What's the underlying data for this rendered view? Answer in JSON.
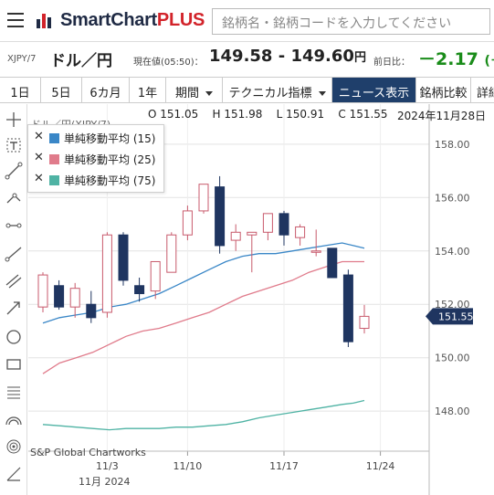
{
  "header": {
    "logo_text": "SmartChart",
    "logo_suffix": "PLUS",
    "search_placeholder": "銘柄名・銘柄コードを入力してください"
  },
  "quote": {
    "code": "XJPY/7",
    "name": "ドル／円",
    "current_label": "現在値(05:50)：",
    "price": "149.58 - 149.60",
    "price_unit": "円",
    "prev_label": "前日比：",
    "change": "－2.17",
    "change_suffix": "(－",
    "change_color": "#1a8c1a"
  },
  "tabs": [
    {
      "label": "1日"
    },
    {
      "label": "5日"
    },
    {
      "label": "6カ月"
    },
    {
      "label": "1年"
    },
    {
      "label": "期間"
    },
    {
      "label": "テクニカル指標"
    },
    {
      "label": "ニュース表示"
    },
    {
      "label": "銘柄比較"
    },
    {
      "label": "詳細"
    }
  ],
  "tools": [
    "crosshair-icon",
    "text-icon",
    "line-icon",
    "trend-icon",
    "horizontal-line-icon",
    "ray-icon",
    "channel-icon",
    "arrow-icon",
    "circle-icon",
    "rectangle-icon",
    "fibonacci-icon",
    "arc-icon",
    "spiral-icon",
    "measure-icon"
  ],
  "ohlc": {
    "o": "O 151.05",
    "h": "H 151.98",
    "l": "L 150.91",
    "c": "C 151.55"
  },
  "date": "2024年11月28日",
  "chart_title_ghost": "ドル／円(XJPY/7)",
  "legend": [
    {
      "x": "✕",
      "label": "単純移動平均 (15)",
      "color": "#3a87c7"
    },
    {
      "x": "✕",
      "label": "単純移動平均 (25)",
      "color": "#e07b8b"
    },
    {
      "x": "✕",
      "label": "単純移動平均 (75)",
      "color": "#4fb3a4"
    }
  ],
  "watermark": "S&P Global Chartworks",
  "x_month_label": "11月 2024",
  "chart_data": {
    "type": "candlestick",
    "ylim": [
      146.5,
      159.5
    ],
    "y_ticks": [
      "158.00",
      "156.00",
      "154.00",
      "152.00",
      "150.00",
      "148.00"
    ],
    "y_tick_values": [
      158,
      156,
      154,
      152,
      150,
      148
    ],
    "x_ticks": [
      {
        "i": 4,
        "label": "11/3"
      },
      {
        "i": 9,
        "label": "11/10"
      },
      {
        "i": 15,
        "label": "11/17"
      },
      {
        "i": 21,
        "label": "11/24"
      }
    ],
    "candles": [
      {
        "o": 151.9,
        "h": 153.2,
        "l": 151.7,
        "c": 153.1
      },
      {
        "o": 152.7,
        "h": 152.9,
        "l": 151.8,
        "c": 151.9
      },
      {
        "o": 151.9,
        "h": 152.8,
        "l": 151.5,
        "c": 152.6
      },
      {
        "o": 152.0,
        "h": 152.5,
        "l": 151.3,
        "c": 151.5
      },
      {
        "o": 151.7,
        "h": 154.7,
        "l": 151.5,
        "c": 154.6
      },
      {
        "o": 154.6,
        "h": 154.7,
        "l": 152.7,
        "c": 152.9
      },
      {
        "o": 152.7,
        "h": 153.0,
        "l": 152.1,
        "c": 152.4
      },
      {
        "o": 152.5,
        "h": 153.6,
        "l": 152.2,
        "c": 153.6
      },
      {
        "o": 153.2,
        "h": 154.7,
        "l": 153.2,
        "c": 154.6
      },
      {
        "o": 154.6,
        "h": 155.7,
        "l": 154.4,
        "c": 155.5
      },
      {
        "o": 155.5,
        "h": 156.5,
        "l": 155.4,
        "c": 156.5
      },
      {
        "o": 156.4,
        "h": 156.8,
        "l": 153.9,
        "c": 154.2
      },
      {
        "o": 154.4,
        "h": 155.0,
        "l": 154.0,
        "c": 154.7
      },
      {
        "o": 154.6,
        "h": 154.7,
        "l": 153.2,
        "c": 154.7
      },
      {
        "o": 154.7,
        "h": 155.4,
        "l": 154.4,
        "c": 155.4
      },
      {
        "o": 155.4,
        "h": 155.5,
        "l": 154.2,
        "c": 154.6
      },
      {
        "o": 154.5,
        "h": 155.0,
        "l": 154.2,
        "c": 154.9
      },
      {
        "o": 154.0,
        "h": 154.8,
        "l": 153.8,
        "c": 154.0
      },
      {
        "o": 154.1,
        "h": 153.9,
        "l": 153.1,
        "c": 153.0
      },
      {
        "o": 153.1,
        "h": 153.3,
        "l": 150.4,
        "c": 150.6
      },
      {
        "o": 151.1,
        "h": 151.98,
        "l": 150.91,
        "c": 151.55
      }
    ],
    "ma15": [
      151.3,
      151.5,
      151.6,
      151.7,
      151.9,
      152.0,
      152.2,
      152.4,
      152.7,
      153.0,
      153.3,
      153.6,
      153.8,
      153.9,
      153.9,
      154.0,
      154.1,
      154.2,
      154.3,
      154.2,
      154.1
    ],
    "ma25": [
      149.4,
      149.8,
      150.0,
      150.2,
      150.5,
      150.8,
      151.0,
      151.1,
      151.3,
      151.5,
      151.7,
      152.0,
      152.3,
      152.5,
      152.7,
      152.9,
      153.2,
      153.4,
      153.6,
      153.6,
      153.6
    ],
    "ma75": [
      147.5,
      147.45,
      147.4,
      147.35,
      147.3,
      147.35,
      147.35,
      147.35,
      147.4,
      147.4,
      147.45,
      147.5,
      147.6,
      147.75,
      147.85,
      147.95,
      148.05,
      148.15,
      148.25,
      148.3,
      148.4
    ],
    "ma_x": [
      0,
      1.5,
      3,
      4.5,
      6,
      7.5,
      9,
      10.5,
      12,
      13.5,
      15,
      16.5,
      18,
      19.5,
      21,
      22.5,
      24,
      25.5,
      27,
      28,
      29
    ],
    "last_price": "151.55",
    "colors": {
      "up": "#e8a3ad",
      "down": "#1f3560",
      "ma15": "#3a87c7",
      "ma25": "#e07b8b",
      "ma75": "#4fb3a4",
      "last": "#1f3560"
    }
  }
}
